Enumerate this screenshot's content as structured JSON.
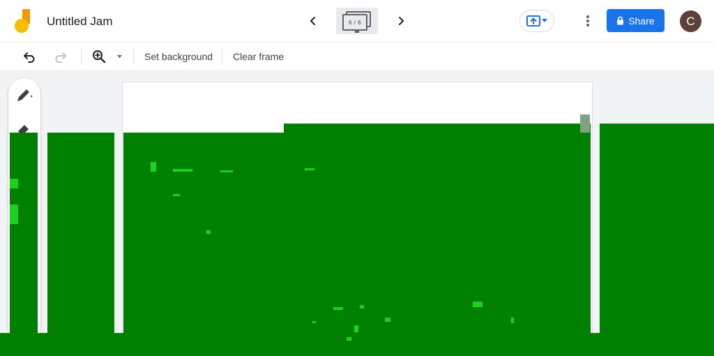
{
  "header": {
    "title": "Untitled Jam",
    "frame_indicator": "6 / 6",
    "share_label": "Share",
    "avatar_initial": "C"
  },
  "toolbar": {
    "set_background_label": "Set background",
    "clear_frame_label": "Clear frame"
  },
  "colors": {
    "brand_yellow": "#fbbc04",
    "brand_orange": "#f29900",
    "share_blue": "#1a73e8",
    "avatar_brown": "#5d4037",
    "drawing_green": "#008000"
  },
  "icons": {
    "logo": "jamboard-logo",
    "prev": "chevron-left-icon",
    "next": "chevron-right-icon",
    "present": "cast-present-icon",
    "more": "more-vert-icon",
    "lock": "lock-icon",
    "undo": "undo-icon",
    "redo": "redo-icon",
    "zoom": "zoom-in-icon",
    "pen": "pen-icon",
    "eraser": "eraser-icon"
  }
}
